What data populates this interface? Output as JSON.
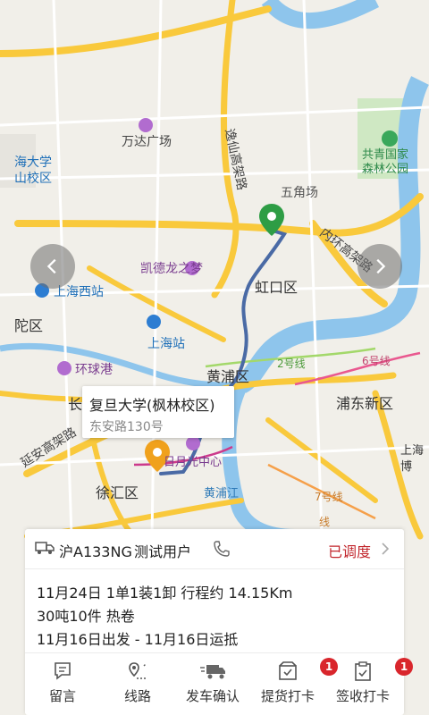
{
  "map": {
    "labels": {
      "wanda": "万达广场",
      "fudan_top": "海大学",
      "fudan_top2": "山校区",
      "yixian": "逸仙高架路",
      "wujiaochang": "五角场",
      "gongqing1": "共青国家",
      "gongqing2": "森林公园",
      "kaidelong": "凯德龙之梦",
      "hongkou": "虹口区",
      "neihuan": "内环高架路",
      "shanghaixi": "上海西站",
      "putuo": "陀区",
      "shanghaizhan": "上海站",
      "huanqiugang": "环球港",
      "huangpu": "黄浦区",
      "erhaoxian": "2号线",
      "liuhaoxian": "6号线",
      "pudong": "浦东新区",
      "yanan": "延安高架路",
      "chang": "长",
      "riyue": "日月光中心",
      "xuhui": "徐汇区",
      "huangpujiang": "黄浦江",
      "qihaoxian": "7号线",
      "shanghai_bo": "上海",
      "bo": "博",
      "xian": "线"
    }
  },
  "popup": {
    "title": "复旦大学(枫林校区)",
    "address": "东安路130号"
  },
  "card": {
    "plate": "沪A133NG",
    "user": "测试用户",
    "status": "已调度",
    "line1": "11月24日 1单1装1卸 行程约 14.15Km",
    "line2": "30吨10件 热卷",
    "line3": "11月16日出发 - 11月16日运抵"
  },
  "tabs": [
    {
      "label": "留言",
      "icon": "message-icon"
    },
    {
      "label": "线路",
      "icon": "route-icon"
    },
    {
      "label": "发车确认",
      "icon": "truck-depart-icon"
    },
    {
      "label": "提货打卡",
      "icon": "pickup-checkin-icon",
      "badge": "1"
    },
    {
      "label": "签收打卡",
      "icon": "sign-checkin-icon",
      "badge": "1"
    }
  ],
  "colors": {
    "route": "#4a6aa5",
    "status": "#c2272d",
    "badge": "#d9262c",
    "start_pin": "#2e9d45",
    "end_pin": "#f0a11c",
    "highway": "#f9c93c",
    "river": "#8ec5ec"
  }
}
